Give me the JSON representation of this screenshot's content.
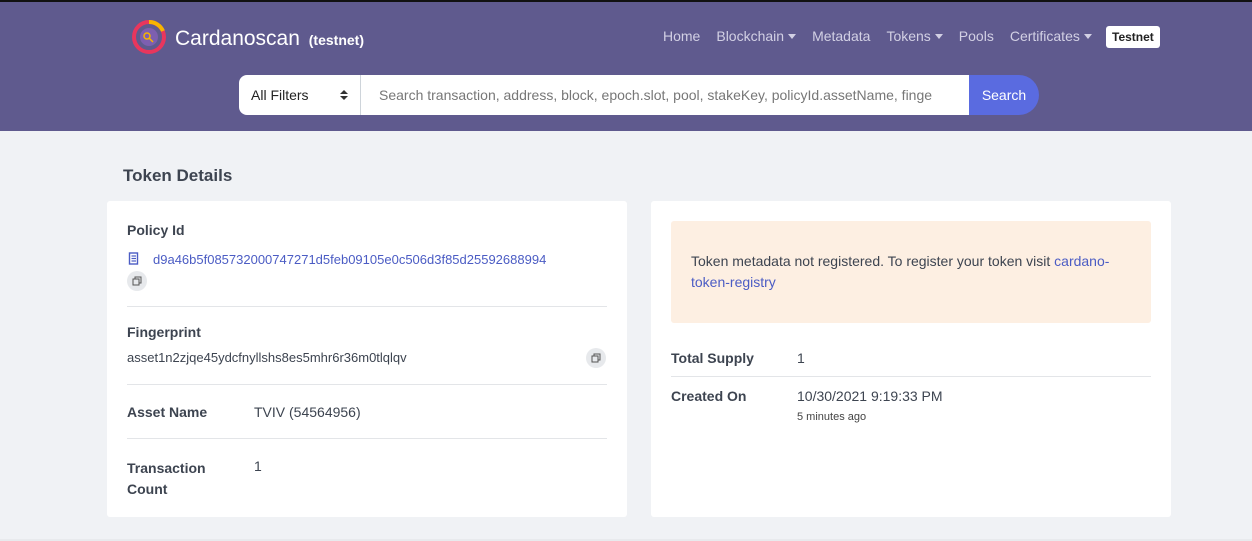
{
  "brand": {
    "name": "Cardanoscan",
    "network_tag": "(testnet)"
  },
  "nav": {
    "items": [
      {
        "label": "Home",
        "dropdown": false
      },
      {
        "label": "Blockchain",
        "dropdown": true
      },
      {
        "label": "Metadata",
        "dropdown": false
      },
      {
        "label": "Tokens",
        "dropdown": true
      },
      {
        "label": "Pools",
        "dropdown": false
      },
      {
        "label": "Certificates",
        "dropdown": true
      }
    ],
    "network_badge": "Testnet"
  },
  "search": {
    "filter_value": "All Filters",
    "placeholder": "Search transaction, address, block, epoch.slot, pool, stakeKey, policyId.assetName, finge",
    "button_label": "Search"
  },
  "page": {
    "title": "Token Details"
  },
  "token": {
    "policy_label": "Policy Id",
    "policy_id": "d9a46b5f085732000747271d5feb09105e0c506d3f85d25592688994",
    "fingerprint_label": "Fingerprint",
    "fingerprint": "asset1n2zjqe45ydcfnyllshs8es5mhr6r36m0tlqlqv",
    "asset_name_label": "Asset Name",
    "asset_name": "TVIV (54564956)",
    "tx_count_label_1": "Transaction",
    "tx_count_label_2": "Count",
    "tx_count": "1"
  },
  "metadata_notice": {
    "text": "Token metadata not registered. To register your token visit ",
    "link_part1": "cardano-",
    "link_part2": "token-registry"
  },
  "supply": {
    "total_supply_label": "Total Supply",
    "total_supply": "1",
    "created_on_label": "Created On",
    "created_on": "10/30/2021 9:19:33 PM",
    "created_ago": "5 minutes ago"
  },
  "colors": {
    "header": "#5f5a8e",
    "accent": "#5a6be0",
    "link": "#4b5cc4",
    "notice_bg": "#fdefe2"
  }
}
